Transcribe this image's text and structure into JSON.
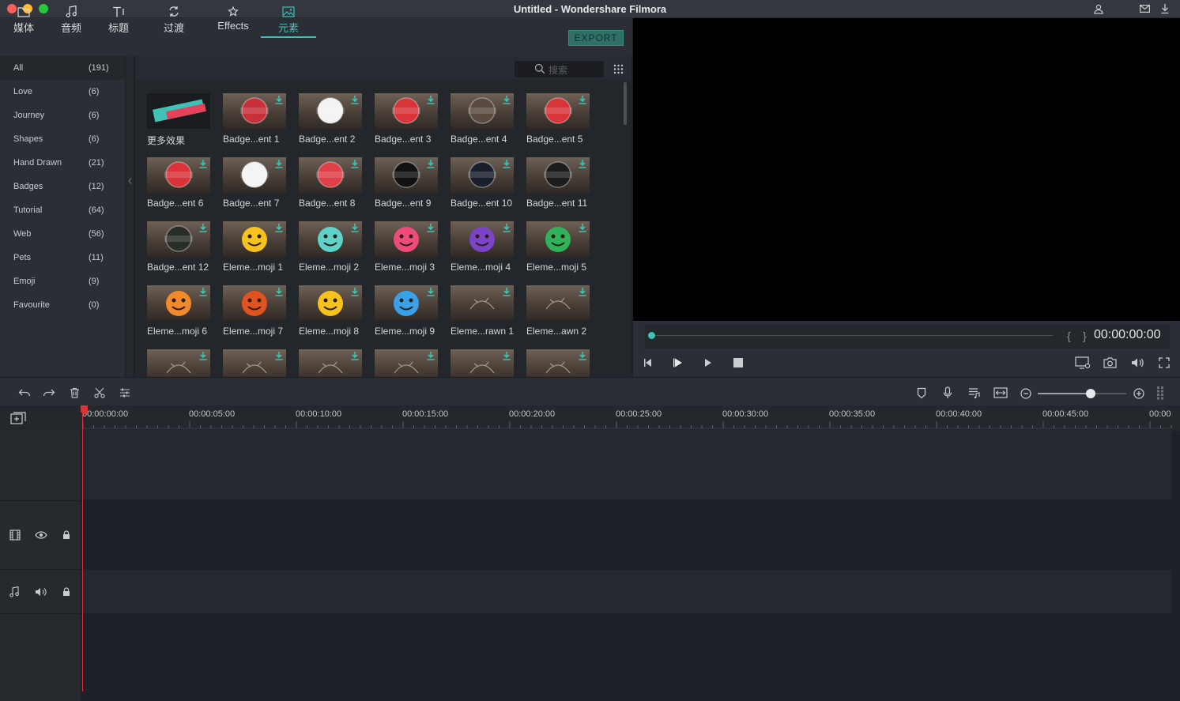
{
  "window": {
    "title": "Untitled - Wondershare Filmora"
  },
  "tabs": [
    {
      "label": "媒体",
      "icon": "folder-icon"
    },
    {
      "label": "音频",
      "icon": "music-note-icon"
    },
    {
      "label": "标题",
      "icon": "text-title-icon"
    },
    {
      "label": "过渡",
      "icon": "transition-icon"
    },
    {
      "label": "Effects",
      "icon": "effects-icon"
    },
    {
      "label": "元素",
      "icon": "image-element-icon",
      "active": true
    }
  ],
  "export_label": "EXPORT",
  "search": {
    "placeholder": "搜索"
  },
  "categories": [
    {
      "name": "All",
      "count": "(191)"
    },
    {
      "name": "Love",
      "count": "(6)"
    },
    {
      "name": "Journey",
      "count": "(6)"
    },
    {
      "name": "Shapes",
      "count": "(6)"
    },
    {
      "name": "Hand Drawn",
      "count": "(21)"
    },
    {
      "name": "Badges",
      "count": "(12)"
    },
    {
      "name": "Tutorial",
      "count": "(64)"
    },
    {
      "name": "Web",
      "count": "(56)"
    },
    {
      "name": "Pets",
      "count": "(11)"
    },
    {
      "name": "Emoji",
      "count": "(9)"
    },
    {
      "name": "Favourite",
      "count": "(0)"
    }
  ],
  "elements": [
    {
      "label": "更多效果",
      "art": "store",
      "text": "FILMORA EFFECTS STORE"
    },
    {
      "label": "Badge...ent 1",
      "art": "badge",
      "color": "#c8303a",
      "text": "ADVENTURE"
    },
    {
      "label": "Badge...ent 2",
      "art": "badge",
      "color": "#f2f2f2",
      "text": ""
    },
    {
      "label": "Badge...ent 3",
      "art": "badge",
      "color": "#d8343a",
      "text": "NEW"
    },
    {
      "label": "Badge...ent 4",
      "art": "badge",
      "color": "#5a4a40",
      "text": "Best"
    },
    {
      "label": "Badge...ent 5",
      "art": "badge",
      "color": "#d8343a",
      "text": "APPROVED"
    },
    {
      "label": "Badge...ent 6",
      "art": "badge",
      "color": "#d8343a",
      "text": "VINTAGE"
    },
    {
      "label": "Badge...ent 7",
      "art": "badge",
      "color": "#f4f4f4",
      "text": "Premium"
    },
    {
      "label": "Badge...ent 8",
      "art": "badge",
      "color": "#e04048",
      "text": "SALE"
    },
    {
      "label": "Badge...ent 9",
      "art": "badge",
      "color": "#111111",
      "text": ""
    },
    {
      "label": "Badge...ent 10",
      "art": "badge",
      "color": "#1a1f2e",
      "text": "POPULAR"
    },
    {
      "label": "Badge...ent 11",
      "art": "badge",
      "color": "#1c1c1c",
      "text": "MADE FRESH"
    },
    {
      "label": "Badge...ent 12",
      "art": "badge",
      "color": "#2a2e28",
      "text": "ORGANIC"
    },
    {
      "label": "Eleme...moji 1",
      "art": "emoji",
      "color": "#f6c21e"
    },
    {
      "label": "Eleme...moji 2",
      "art": "emoji",
      "color": "#5ed1c8"
    },
    {
      "label": "Eleme...moji 3",
      "art": "emoji",
      "color": "#ee4a7a"
    },
    {
      "label": "Eleme...moji 4",
      "art": "emoji",
      "color": "#7c43c9"
    },
    {
      "label": "Eleme...moji 5",
      "art": "emoji",
      "color": "#2fb35a"
    },
    {
      "label": "Eleme...moji 6",
      "art": "emoji",
      "color": "#f08a2a"
    },
    {
      "label": "Eleme...moji 7",
      "art": "emoji",
      "color": "#e0531e"
    },
    {
      "label": "Eleme...moji 8",
      "art": "emoji",
      "color": "#f6c21e"
    },
    {
      "label": "Eleme...moji 9",
      "art": "emoji",
      "color": "#3aa0e8"
    },
    {
      "label": "Eleme...rawn 1",
      "art": "drawn",
      "color": "#e8e2d8"
    },
    {
      "label": "Eleme...awn 2",
      "art": "drawn",
      "color": "#e8e2d8"
    },
    {
      "label": "",
      "art": "drawn",
      "color": "#e8e2d8"
    },
    {
      "label": "",
      "art": "drawn",
      "color": "#e8e2d8"
    },
    {
      "label": "",
      "art": "drawn",
      "color": "#e8e2d8"
    },
    {
      "label": "",
      "art": "drawn",
      "color": "#e8e2d8"
    },
    {
      "label": "",
      "art": "drawn",
      "color": "#e8e2d8"
    },
    {
      "label": "",
      "art": "drawn",
      "color": "#e8e2d8"
    }
  ],
  "preview": {
    "timecode": "00:00:00:00"
  },
  "ruler": [
    "00:00:00:00",
    "00:00:05:00",
    "00:00:10:00",
    "00:00:15:00",
    "00:00:20:00",
    "00:00:25:00",
    "00:00:30:00",
    "00:00:35:00",
    "00:00:40:00",
    "00:00:45:00",
    "00:00"
  ],
  "colors": {
    "accent": "#3fc1b6",
    "playhead": "#d8343a"
  }
}
